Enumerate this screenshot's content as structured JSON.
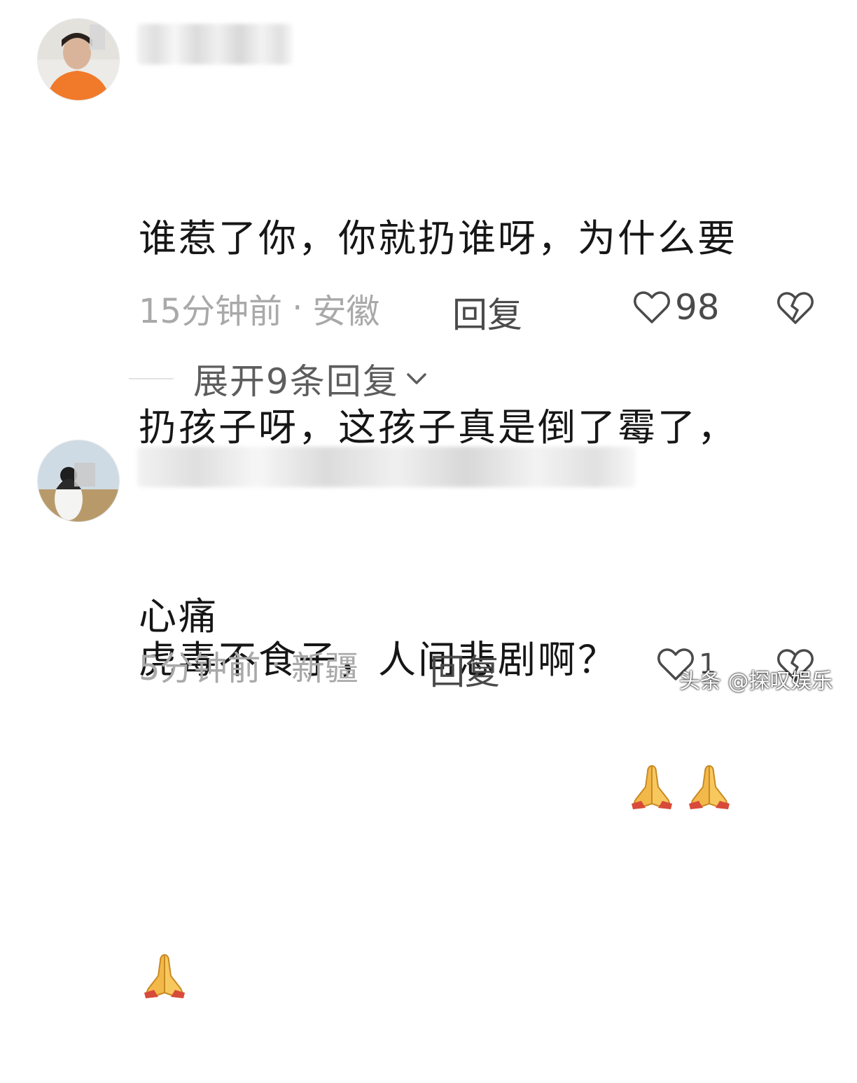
{
  "comments": [
    {
      "text_line1": "谁惹了你，你就扔谁呀，为什么要",
      "text_line2": "扔孩子呀，这孩子真是倒了霉了，",
      "text_line3": "心痛",
      "time": "15分钟前",
      "separator": "·",
      "location": "安徽",
      "reply_label": "回复",
      "likes": "98",
      "expand_label": "展开9条回复"
    },
    {
      "text_line1": "虎毒不食子，人间悲剧啊？",
      "time": "5分钟前",
      "separator": "·",
      "location": "新疆",
      "reply_label": "回复",
      "likes": "1"
    }
  ],
  "watermark": "头条 @探叹娱乐",
  "icons": {
    "like": "heart-outline-icon",
    "dislike": "broken-heart-icon",
    "expand": "chevron-down-icon",
    "emoji": "folded-hands-emoji"
  },
  "colors": {
    "text": "#161616",
    "meta": "#a9a9a9",
    "action": "#4a4a4a",
    "emoji": "#f3b84a"
  }
}
